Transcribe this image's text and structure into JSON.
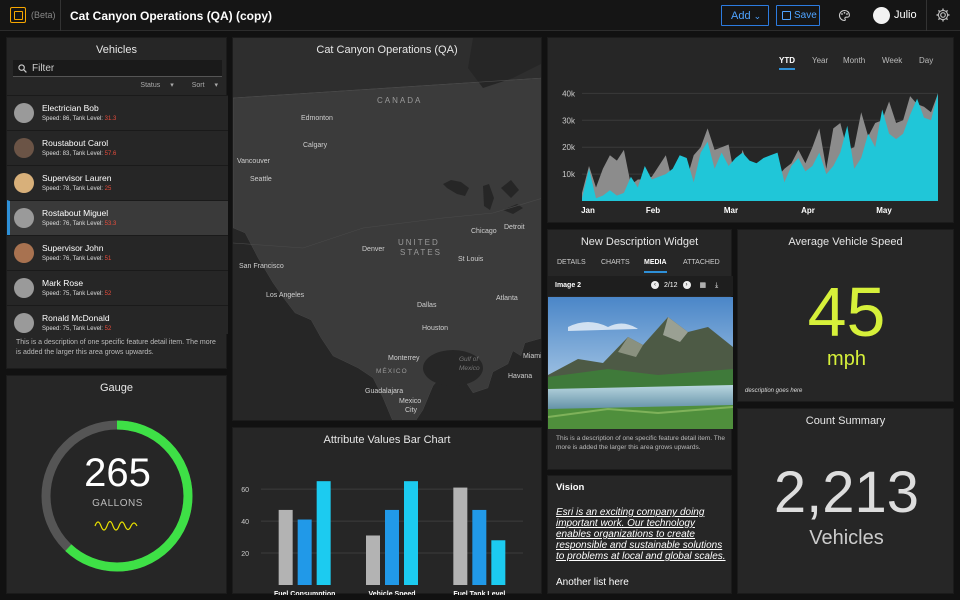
{
  "header": {
    "beta": "(Beta)",
    "title": "Cat Canyon Operations (QA) (copy)",
    "add_label": "Add",
    "save_label": "Save",
    "user_name": "Julio"
  },
  "vehicles": {
    "title": "Vehicles",
    "filter_placeholder": "Filter",
    "status_label": "Status",
    "sort_label": "Sort",
    "items": [
      {
        "name": "Electrician Bob",
        "stats": "Speed: 86, Tank Level: ",
        "tank": "31.3"
      },
      {
        "name": "Roustabout Carol",
        "stats": "Speed: 83, Tank Level: ",
        "tank": "57.6"
      },
      {
        "name": "Supervisor Lauren",
        "stats": "Speed: 78, Tank Level: ",
        "tank": "25"
      },
      {
        "name": "Rostabout Miguel",
        "stats": "Speed: 76, Tank Level: ",
        "tank": "53.3"
      },
      {
        "name": "Supervisor John",
        "stats": "Speed: 76, Tank Level: ",
        "tank": "51"
      },
      {
        "name": "Mark Rose",
        "stats": "Speed: 75, Tank Level: ",
        "tank": "52"
      },
      {
        "name": "Ronald McDonald",
        "stats": "Speed: 75, Tank Level: ",
        "tank": "52"
      }
    ],
    "description": "This is a description of one specific feature detail item. The more is added the larger this area grows upwards."
  },
  "gauge": {
    "title": "Gauge",
    "value": "265",
    "unit": "GALLONS",
    "fill_fraction": 0.62
  },
  "map": {
    "title": "Cat Canyon Operations (QA)",
    "countries": [
      "CANADA",
      "UNITED",
      "STATES",
      "MÉXICO"
    ],
    "water": [
      "Gulf of",
      "Mexico"
    ],
    "cities": [
      "Edmonton",
      "Calgary",
      "Vancouver",
      "Seattle",
      "Chicago",
      "Detroit",
      "Denver",
      "St Louis",
      "San Francisco",
      "Los Angeles",
      "Dallas",
      "Atlanta",
      "Houston",
      "Monterrey",
      "Miami",
      "Havana",
      "Guadalajara",
      "Mexico",
      "City"
    ]
  },
  "bar_chart": {
    "title": "Attribute Values Bar Chart"
  },
  "area_chart_tabs": {
    "items": [
      "YTD",
      "Year",
      "Month",
      "Week",
      "Day"
    ],
    "active": "YTD"
  },
  "description_widget": {
    "title": "New Description Widget",
    "tabs": [
      "DETAILS",
      "CHARTS",
      "MEDIA",
      "ATTACHED"
    ],
    "active_tab": "MEDIA",
    "image_label": "Image 2",
    "pager": "2/12",
    "description": "This is a description of one specific feature detail item. The more is added the larger this area grows upwards."
  },
  "speed": {
    "title": "Average Vehicle Speed",
    "value": "45",
    "unit": "mph",
    "description": "description goes here"
  },
  "count": {
    "title": "Count Summary",
    "value": "2,213",
    "unit": "Vehicles"
  },
  "vision": {
    "title": "Vision",
    "text": "Esri is an exciting company doing important work. Our technology enables organizations to create responsible and sustainable solutions to problems at local and global scales.",
    "list_label": "Another list here"
  },
  "colors": {
    "accent": "#2e90d8",
    "speed": "#d6f03a",
    "gauge": "#3ee046",
    "tank_level": "#e74c3c",
    "area_cyan": "#20c6d8",
    "area_gray": "#8c8c8c",
    "bar_gray": "#b3b3b3",
    "bar_blue": "#2199e8",
    "bar_cyan": "#1ccbf0"
  },
  "chart_data": [
    {
      "type": "bar",
      "title": "Attribute Values Bar Chart",
      "categories": [
        "Fuel Consumption",
        "Vehicle Speed",
        "Fuel Tank Level"
      ],
      "series": [
        {
          "values": [
            47,
            31,
            61
          ]
        },
        {
          "values": [
            41,
            47,
            47
          ]
        },
        {
          "values": [
            65,
            65,
            28
          ]
        }
      ],
      "yticks": [
        20,
        40,
        60
      ],
      "ylim": [
        0,
        72
      ],
      "grid": true
    },
    {
      "type": "area",
      "xticks": [
        "Jan",
        "Feb",
        "Mar",
        "Apr",
        "May"
      ],
      "yticks": [
        "10k",
        "20k",
        "30k",
        "40k"
      ],
      "ylim": [
        0,
        42
      ],
      "grid": true,
      "series": [
        {
          "values": [
            3,
            13,
            5,
            12,
            17,
            15,
            19,
            6,
            8,
            8,
            9,
            13,
            17,
            7,
            15,
            8,
            17,
            20,
            27,
            19,
            20,
            21,
            7,
            19,
            12,
            14,
            10,
            17,
            9,
            12,
            14,
            19,
            14,
            20,
            27,
            12,
            27,
            29,
            19,
            20,
            33,
            24,
            29,
            30,
            37,
            29,
            30,
            39,
            36,
            35,
            33,
            40
          ]
        },
        {
          "values": [
            1,
            12,
            1,
            2,
            4,
            2,
            3,
            9,
            5,
            13,
            8,
            9,
            10,
            12,
            17,
            16,
            7,
            18,
            22,
            12,
            18,
            13,
            16,
            18,
            15,
            14,
            16,
            17,
            18,
            7,
            13,
            16,
            11,
            13,
            18,
            10,
            13,
            18,
            28,
            12,
            16,
            25,
            20,
            34,
            25,
            23,
            25,
            32,
            38,
            31,
            30,
            40
          ]
        }
      ]
    }
  ]
}
